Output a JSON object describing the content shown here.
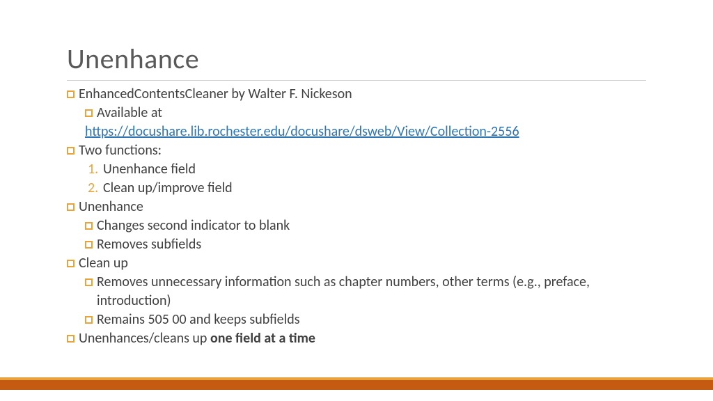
{
  "title": "Unenhance",
  "items": {
    "b1": "EnhancedContentsCleaner by Walter F. Nickeson",
    "b1a": "Available at",
    "b1a_link": "https://docushare.lib.rochester.edu/docushare/dsweb/View/Collection-2556",
    "b2": "Two functions:",
    "b2_n1_marker": "1.",
    "b2_n1": "Unenhance field",
    "b2_n2_marker": "2.",
    "b2_n2": "Clean up/improve field",
    "b3": "Unenhance",
    "b3a": "Changes second indicator to blank",
    "b3b": "Removes subfields",
    "b4": "Clean up",
    "b4a": "Removes unnecessary information such as chapter numbers, other terms (e.g., preface, introduction)",
    "b4b": "Remains 505 00 and keeps subfields",
    "b5_pre": "Unenhances/cleans up ",
    "b5_bold": "one field at a time"
  }
}
